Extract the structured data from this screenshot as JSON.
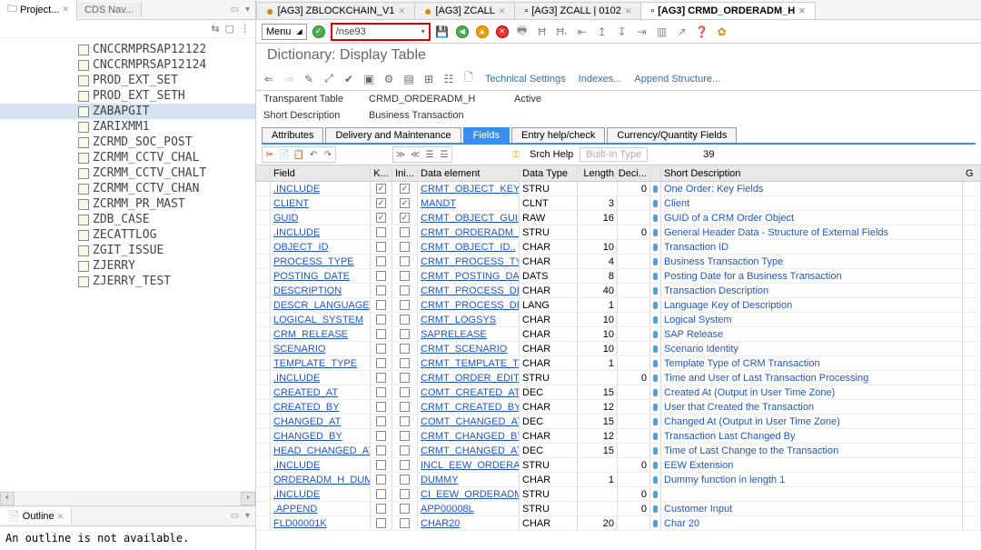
{
  "project": {
    "tab_project": "Project...",
    "tab_cds": "CDS Nav...",
    "items": [
      "CNCCRMPRSAP12122",
      "CNCCRMPRSAP12124",
      "PROD_EXT_SET",
      "PROD_EXT_SETH",
      "ZABAPGIT",
      "ZARIXMM1",
      "ZCRMD_SOC_POST",
      "ZCRMM_CCTV_CHAL",
      "ZCRMM_CCTV_CHALT",
      "ZCRMM_CCTV_CHAN",
      "ZCRMM_PR_MAST",
      "ZDB_CASE",
      "ZECATTLOG",
      "ZGIT_ISSUE",
      "ZJERRY",
      "ZJERRY_TEST"
    ],
    "selected": "ZABAPGIT"
  },
  "outline": {
    "tab": "Outline",
    "msg": "An outline is not available."
  },
  "editor_tabs": [
    {
      "label": "[AG3] ZBLOCKCHAIN_V1",
      "dirty": true,
      "active": false
    },
    {
      "label": "[AG3] ZCALL",
      "dirty": true,
      "active": false
    },
    {
      "label": "[AG3] ZCALL | 0102",
      "dirty": false,
      "active": false
    },
    {
      "label": "[AG3] CRMD_ORDERADM_H",
      "dirty": false,
      "active": true
    }
  ],
  "toolbar": {
    "menu": "Menu",
    "search_value": "/nse93"
  },
  "dict": {
    "title": "Dictionary: Display Table",
    "tech_settings": "Technical Settings",
    "indexes": "Indexes...",
    "append": "Append Structure..."
  },
  "header": {
    "tt_label": "Transparent Table",
    "tt_value": "CRMD_ORDERADM_H",
    "status": "Active",
    "sd_label": "Short Description",
    "sd_value": "Business Transaction"
  },
  "dd_tabs": [
    "Attributes",
    "Delivery and Maintenance",
    "Fields",
    "Entry help/check",
    "Currency/Quantity Fields"
  ],
  "dd_active": "Fields",
  "grid": {
    "srch": "Srch Help",
    "builtin": "Built-In Type",
    "count": "39",
    "cols": {
      "field": "Field",
      "k": "K...",
      "ini": "Ini...",
      "de": "Data element",
      "dt": "Data Type",
      "len": "Length",
      "dec": "Deci...",
      "desc": "Short Description",
      "g": "G"
    },
    "rows": [
      {
        "field": ".INCLUDE",
        "k": true,
        "ini": true,
        "de": "CRMT_OBJECT_KEY",
        "dt": "STRU",
        "len": "",
        "dec": "0",
        "bull": true,
        "desc": "One Order: Key Fields"
      },
      {
        "field": "CLIENT",
        "k": true,
        "ini": true,
        "de": "MANDT",
        "dt": "CLNT",
        "len": "3",
        "dec": "",
        "bull": true,
        "desc": "Client"
      },
      {
        "field": "GUID",
        "k": true,
        "ini": true,
        "de": "CRMT_OBJECT_GUID",
        "dt": "RAW",
        "len": "16",
        "dec": "",
        "bull": true,
        "desc": "GUID of a CRM Order Object"
      },
      {
        "field": ".INCLUDE",
        "k": false,
        "ini": false,
        "de": "CRMT_ORDERADM_H..",
        "dt": "STRU",
        "len": "",
        "dec": "0",
        "bull": true,
        "desc": "General Header Data - Structure of External Fields"
      },
      {
        "field": "OBJECT_ID",
        "k": false,
        "ini": false,
        "de": "CRMT_OBJECT_ID..",
        "dt": "CHAR",
        "len": "10",
        "dec": "",
        "bull": true,
        "desc": "Transaction ID"
      },
      {
        "field": "PROCESS_TYPE",
        "k": false,
        "ini": false,
        "de": "CRMT_PROCESS_TY..",
        "dt": "CHAR",
        "len": "4",
        "dec": "",
        "bull": true,
        "desc": "Business Transaction Type"
      },
      {
        "field": "POSTING_DATE",
        "k": false,
        "ini": false,
        "de": "CRMT_POSTING_DA..",
        "dt": "DATS",
        "len": "8",
        "dec": "",
        "bull": true,
        "desc": "Posting Date for a Business Transaction"
      },
      {
        "field": "DESCRIPTION",
        "k": false,
        "ini": false,
        "de": "CRMT_PROCESS_DE..",
        "dt": "CHAR",
        "len": "40",
        "dec": "",
        "bull": true,
        "desc": "Transaction Description"
      },
      {
        "field": "DESCR_LANGUAGE",
        "k": false,
        "ini": false,
        "de": "CRMT_PROCESS_DE..",
        "dt": "LANG",
        "len": "1",
        "dec": "",
        "bull": true,
        "desc": "Language Key of Description"
      },
      {
        "field": "LOGICAL_SYSTEM",
        "k": false,
        "ini": false,
        "de": "CRMT_LOGSYS",
        "dt": "CHAR",
        "len": "10",
        "dec": "",
        "bull": true,
        "desc": "Logical System"
      },
      {
        "field": "CRM_RELEASE",
        "k": false,
        "ini": false,
        "de": "SAPRELEASE",
        "dt": "CHAR",
        "len": "10",
        "dec": "",
        "bull": true,
        "desc": "SAP Release"
      },
      {
        "field": "SCENARIO",
        "k": false,
        "ini": false,
        "de": "CRMT_SCENARIO",
        "dt": "CHAR",
        "len": "10",
        "dec": "",
        "bull": true,
        "desc": "Scenario Identity"
      },
      {
        "field": "TEMPLATE_TYPE",
        "k": false,
        "ini": false,
        "de": "CRMT_TEMPLATE_T..",
        "dt": "CHAR",
        "len": "1",
        "dec": "",
        "bull": true,
        "desc": "Template Type of CRM Transaction"
      },
      {
        "field": ".INCLUDE",
        "k": false,
        "ini": false,
        "de": "CRMT_ORDER_EDIT..",
        "dt": "STRU",
        "len": "",
        "dec": "0",
        "bull": true,
        "desc": "Time and User of Last Transaction Processing"
      },
      {
        "field": "CREATED_AT",
        "k": false,
        "ini": false,
        "de": "COMT_CREATED_AT..",
        "dt": "DEC",
        "len": "15",
        "dec": "",
        "bull": true,
        "desc": "Created At (Output in User Time Zone)"
      },
      {
        "field": "CREATED_BY",
        "k": false,
        "ini": false,
        "de": "CRMT_CREATED_BY..",
        "dt": "CHAR",
        "len": "12",
        "dec": "",
        "bull": true,
        "desc": "User that Created the Transaction"
      },
      {
        "field": "CHANGED_AT",
        "k": false,
        "ini": false,
        "de": "COMT_CHANGED_AT..",
        "dt": "DEC",
        "len": "15",
        "dec": "",
        "bull": true,
        "desc": "Changed At (Output in User Time Zone)"
      },
      {
        "field": "CHANGED_BY",
        "k": false,
        "ini": false,
        "de": "CRMT_CHANGED_BY..",
        "dt": "CHAR",
        "len": "12",
        "dec": "",
        "bull": true,
        "desc": "Transaction Last Changed By"
      },
      {
        "field": "HEAD_CHANGED_AT",
        "k": false,
        "ini": false,
        "de": "CRMT_CHANGED_AT..",
        "dt": "DEC",
        "len": "15",
        "dec": "",
        "bull": true,
        "desc": "Time of Last Change to the Transaction"
      },
      {
        "field": ".INCLUDE",
        "k": false,
        "ini": false,
        "de": "INCL_EEW_ORDERA..",
        "dt": "STRU",
        "len": "",
        "dec": "0",
        "bull": true,
        "desc": "EEW Extension"
      },
      {
        "field": "ORDERADM_H_DUMMY",
        "k": false,
        "ini": false,
        "de": "DUMMY",
        "dt": "CHAR",
        "len": "1",
        "dec": "",
        "bull": true,
        "desc": "Dummy function in length 1"
      },
      {
        "field": ".INCLUDE",
        "k": false,
        "ini": false,
        "de": "CI_EEW_ORDERADM..",
        "dt": "STRU",
        "len": "",
        "dec": "0",
        "bull": true,
        "desc": ""
      },
      {
        "field": ".APPEND",
        "k": false,
        "ini": false,
        "de": "APP00008L",
        "dt": "STRU",
        "len": "",
        "dec": "0",
        "bull": true,
        "desc": "Customer Input"
      },
      {
        "field": "FLD00001K",
        "k": false,
        "ini": false,
        "de": "CHAR20",
        "dt": "CHAR",
        "len": "20",
        "dec": "",
        "bull": true,
        "desc": "Char 20"
      }
    ]
  }
}
